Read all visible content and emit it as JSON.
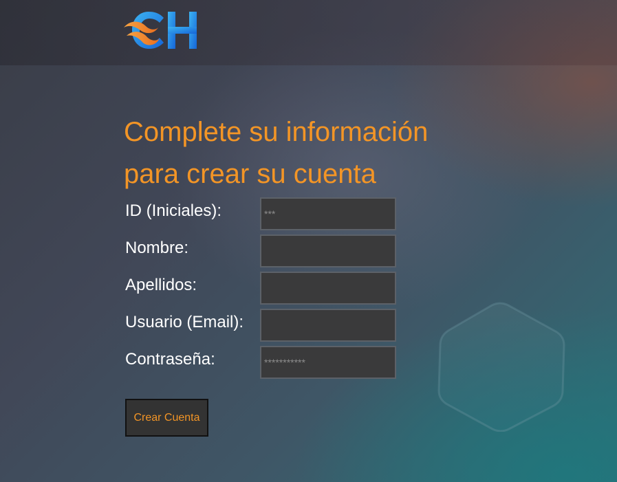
{
  "header": {
    "logo_text": "CH",
    "icon": "ch-logo"
  },
  "title": {
    "line1": "Complete su información",
    "line2": "para crear su cuenta"
  },
  "form": {
    "fields": [
      {
        "label": "ID (Iniciales):",
        "placeholder": "***",
        "value": ""
      },
      {
        "label": "Nombre:",
        "placeholder": "",
        "value": ""
      },
      {
        "label": "Apellidos:",
        "placeholder": "",
        "value": ""
      },
      {
        "label": "Usuario (Email):",
        "placeholder": "",
        "value": ""
      },
      {
        "label": "Contraseña:",
        "placeholder": "***********",
        "value": ""
      }
    ],
    "submit_label": "Crear Cuenta"
  },
  "colors": {
    "accent": "#f39526",
    "input_bg": "#3a3a3b",
    "logo_blue": "#1a7fe0"
  }
}
